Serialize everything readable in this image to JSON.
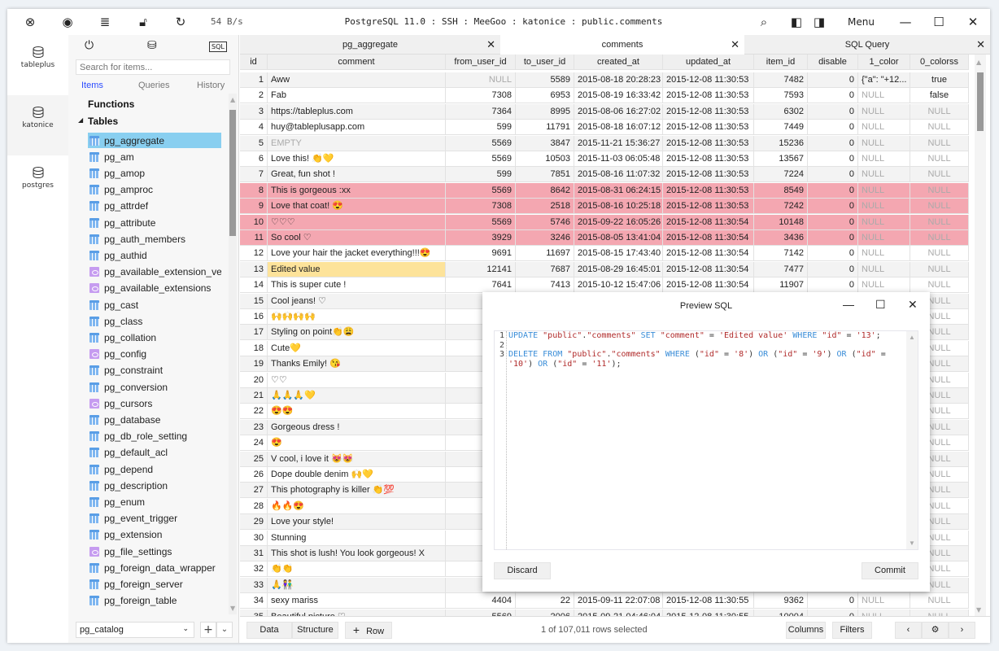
{
  "window": {
    "title": "PostgreSQL 11.0 : SSH : MeeGoo : katonice : public.comments",
    "speed": "54 B/s",
    "menu_label": "Menu",
    "toolbar_icons": [
      "close-connection-icon",
      "preview-icon",
      "sql-log-icon",
      "lock-icon",
      "refresh-icon"
    ],
    "right_icons": [
      "search-icon",
      "toggle-left-panel-icon",
      "toggle-right-panel-icon"
    ]
  },
  "connections": [
    {
      "label": "tableplus",
      "active": true
    },
    {
      "label": "katonice",
      "active": false
    },
    {
      "label": "postgres",
      "active": true
    }
  ],
  "sidebar": {
    "search_placeholder": "Search for items...",
    "tabs": [
      "Items",
      "Queries",
      "History"
    ],
    "active_tab": "Items",
    "functions_label": "Functions",
    "tables_label": "Tables",
    "items": [
      {
        "name": "pg_aggregate",
        "type": "table",
        "selected": true
      },
      {
        "name": "pg_am",
        "type": "table"
      },
      {
        "name": "pg_amop",
        "type": "table"
      },
      {
        "name": "pg_amproc",
        "type": "table"
      },
      {
        "name": "pg_attrdef",
        "type": "table"
      },
      {
        "name": "pg_attribute",
        "type": "table"
      },
      {
        "name": "pg_auth_members",
        "type": "table"
      },
      {
        "name": "pg_authid",
        "type": "table"
      },
      {
        "name": "pg_available_extension_vers",
        "type": "view"
      },
      {
        "name": "pg_available_extensions",
        "type": "view"
      },
      {
        "name": "pg_cast",
        "type": "table"
      },
      {
        "name": "pg_class",
        "type": "table"
      },
      {
        "name": "pg_collation",
        "type": "table"
      },
      {
        "name": "pg_config",
        "type": "view"
      },
      {
        "name": "pg_constraint",
        "type": "table"
      },
      {
        "name": "pg_conversion",
        "type": "table"
      },
      {
        "name": "pg_cursors",
        "type": "view"
      },
      {
        "name": "pg_database",
        "type": "table"
      },
      {
        "name": "pg_db_role_setting",
        "type": "table"
      },
      {
        "name": "pg_default_acl",
        "type": "table"
      },
      {
        "name": "pg_depend",
        "type": "table"
      },
      {
        "name": "pg_description",
        "type": "table"
      },
      {
        "name": "pg_enum",
        "type": "table"
      },
      {
        "name": "pg_event_trigger",
        "type": "table"
      },
      {
        "name": "pg_extension",
        "type": "table"
      },
      {
        "name": "pg_file_settings",
        "type": "view"
      },
      {
        "name": "pg_foreign_data_wrapper",
        "type": "table"
      },
      {
        "name": "pg_foreign_server",
        "type": "table"
      },
      {
        "name": "pg_foreign_table",
        "type": "table"
      }
    ],
    "schema": "pg_catalog"
  },
  "tabs": [
    {
      "label": "pg_aggregate",
      "active": false
    },
    {
      "label": "comments",
      "active": true
    },
    {
      "label": "SQL Query",
      "active": false
    }
  ],
  "grid": {
    "columns": [
      "id",
      "comment",
      "from_user_id",
      "to_user_id",
      "created_at",
      "updated_at",
      "item_id",
      "disable",
      "1_color",
      "0_colorss"
    ],
    "rows": [
      {
        "id": "1",
        "comment": "Aww",
        "from": "NULL",
        "to": "5589",
        "created": "2015-08-18 20:28:23",
        "updated": "2015-12-08 11:30:53",
        "item": "7482",
        "disable": "0",
        "c1": "{\"a\": \"+12...",
        "c0": "true"
      },
      {
        "id": "2",
        "comment": "Fab",
        "from": "7308",
        "to": "6953",
        "created": "2015-08-19 16:33:42",
        "updated": "2015-12-08 11:30:53",
        "item": "7593",
        "disable": "0",
        "c1": "NULL",
        "c0": "false"
      },
      {
        "id": "3",
        "comment": "https://tableplus.com",
        "from": "7364",
        "to": "8995",
        "created": "2015-08-06 16:27:02",
        "updated": "2015-12-08 11:30:53",
        "item": "6302",
        "disable": "0",
        "c1": "NULL",
        "c0": "NULL"
      },
      {
        "id": "4",
        "comment": "huy@tableplusapp.com",
        "from": "599",
        "to": "11791",
        "created": "2015-08-18 16:07:12",
        "updated": "2015-12-08 11:30:53",
        "item": "7449",
        "disable": "0",
        "c1": "NULL",
        "c0": "NULL"
      },
      {
        "id": "5",
        "comment": "EMPTY",
        "from": "5569",
        "to": "3847",
        "created": "2015-11-21 15:36:27",
        "updated": "2015-12-08 11:30:53",
        "item": "15236",
        "disable": "0",
        "c1": "NULL",
        "c0": "NULL"
      },
      {
        "id": "6",
        "comment": "Love this! 👏💛",
        "from": "5569",
        "to": "10503",
        "created": "2015-11-03 06:05:48",
        "updated": "2015-12-08 11:30:53",
        "item": "13567",
        "disable": "0",
        "c1": "NULL",
        "c0": "NULL"
      },
      {
        "id": "7",
        "comment": "Great, fun shot !",
        "from": "599",
        "to": "7851",
        "created": "2015-08-16 11:07:32",
        "updated": "2015-12-08 11:30:53",
        "item": "7224",
        "disable": "0",
        "c1": "NULL",
        "c0": "NULL"
      },
      {
        "id": "8",
        "comment": "This is gorgeous :xx",
        "from": "5569",
        "to": "8642",
        "created": "2015-08-31 06:24:15",
        "updated": "2015-12-08 11:30:53",
        "item": "8549",
        "disable": "0",
        "c1": "NULL",
        "c0": "NULL",
        "state": "deleted"
      },
      {
        "id": "9",
        "comment": "Love that coat! 😍",
        "from": "7308",
        "to": "2518",
        "created": "2015-08-16 10:25:18",
        "updated": "2015-12-08 11:30:53",
        "item": "7242",
        "disable": "0",
        "c1": "NULL",
        "c0": "NULL",
        "state": "deleted"
      },
      {
        "id": "10",
        "comment": "♡♡♡",
        "from": "5569",
        "to": "5746",
        "created": "2015-09-22 16:05:26",
        "updated": "2015-12-08 11:30:54",
        "item": "10148",
        "disable": "0",
        "c1": "NULL",
        "c0": "NULL",
        "state": "deleted"
      },
      {
        "id": "11",
        "comment": "So cool ♡",
        "from": "3929",
        "to": "3246",
        "created": "2015-08-05 13:41:04",
        "updated": "2015-12-08 11:30:54",
        "item": "3436",
        "disable": "0",
        "c1": "NULL",
        "c0": "NULL",
        "state": "deleted"
      },
      {
        "id": "12",
        "comment": "Love your hair the jacket everything!!!😍",
        "from": "9691",
        "to": "11697",
        "created": "2015-08-15 17:43:40",
        "updated": "2015-12-08 11:30:54",
        "item": "7142",
        "disable": "0",
        "c1": "NULL",
        "c0": "NULL"
      },
      {
        "id": "13",
        "comment": "Edited value",
        "from": "12141",
        "to": "7687",
        "created": "2015-08-29 16:45:01",
        "updated": "2015-12-08 11:30:54",
        "item": "7477",
        "disable": "0",
        "c1": "NULL",
        "c0": "NULL",
        "state": "edited"
      },
      {
        "id": "14",
        "comment": "This is super cute    !",
        "from": "7641",
        "to": "7413",
        "created": "2015-10-12 15:47:06",
        "updated": "2015-12-08 11:30:54",
        "item": "11907",
        "disable": "0",
        "c1": "NULL",
        "c0": "NULL"
      },
      {
        "id": "15",
        "comment": "Cool jeans! ♡",
        "c0": "NULL"
      },
      {
        "id": "16",
        "comment": "🙌🙌🙌🙌",
        "c0": "NULL"
      },
      {
        "id": "17",
        "comment": "Styling on point👏😩",
        "c0": "NULL"
      },
      {
        "id": "18",
        "comment": "Cute💛",
        "c0": "NULL"
      },
      {
        "id": "19",
        "comment": "Thanks Emily! 😘",
        "c0": "NULL"
      },
      {
        "id": "20",
        "comment": "♡♡",
        "c0": "NULL"
      },
      {
        "id": "21",
        "comment": "🙏🙏🙏💛",
        "c0": "NULL"
      },
      {
        "id": "22",
        "comment": "😍😍",
        "c0": "NULL"
      },
      {
        "id": "23",
        "comment": "Gorgeous dress !",
        "c0": "NULL"
      },
      {
        "id": "24",
        "comment": "😍",
        "c0": "NULL"
      },
      {
        "id": "25",
        "comment": "V cool, i love it 😻😻",
        "c0": "NULL"
      },
      {
        "id": "26",
        "comment": "Dope double denim 🙌💛",
        "c0": "NULL"
      },
      {
        "id": "27",
        "comment": "This photography is killer 👏💯",
        "c0": "NULL"
      },
      {
        "id": "28",
        "comment": "🔥🔥😍",
        "c0": "NULL"
      },
      {
        "id": "29",
        "comment": "Love your style!",
        "c0": "NULL"
      },
      {
        "id": "30",
        "comment": "Stunning",
        "c0": "NULL"
      },
      {
        "id": "31",
        "comment": "This shot is lush! You look gorgeous! X",
        "c0": "NULL"
      },
      {
        "id": "32",
        "comment": "👏👏",
        "c0": "NULL"
      },
      {
        "id": "33",
        "comment": "🙏👫",
        "c0": "NULL"
      },
      {
        "id": "34",
        "comment": "sexy mariss",
        "from": "4404",
        "to": "22",
        "created": "2015-09-11 22:07:08",
        "updated": "2015-12-08 11:30:55",
        "item": "9362",
        "disable": "0",
        "c1": "NULL",
        "c0": "NULL"
      },
      {
        "id": "35",
        "comment": "Beautiful picture ♡",
        "from": "5569",
        "to": "2006",
        "created": "2015-09-21 04:46:04",
        "updated": "2015-12-08 11:30:55",
        "item": "10004",
        "disable": "0",
        "c1": "NULL",
        "c0": "NULL"
      }
    ]
  },
  "footer": {
    "data_label": "Data",
    "structure_label": "Structure",
    "add_row_label": "Row",
    "status": "1 of 107,011 rows selected",
    "columns_label": "Columns",
    "filters_label": "Filters"
  },
  "dialog": {
    "title": "Preview SQL",
    "line_numbers": [
      "1",
      "2",
      "3"
    ],
    "sql_lines": [
      "UPDATE \"public\".\"comments\" SET \"comment\" = 'Edited value' WHERE \"id\" = '13';",
      "",
      "DELETE FROM \"public\".\"comments\" WHERE (\"id\" = '8') OR (\"id\" = '9') OR (\"id\" = '10') OR (\"id\" = '11');"
    ],
    "discard_label": "Discard",
    "commit_label": "Commit"
  },
  "colors": {
    "deleted_row": "#f4a7b1",
    "edited_cell": "#fde39a",
    "selected_item": "#89cff0",
    "sql_keyword": "#3b8ed8",
    "sql_string": "#b02a2a",
    "active_sidebar_tab": "#2c4cff"
  }
}
